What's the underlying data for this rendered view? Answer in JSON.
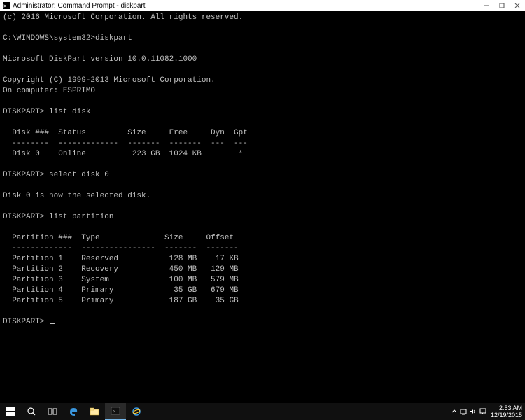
{
  "window": {
    "title": "Administrator: Command Prompt - diskpart",
    "icon": "cmd-icon"
  },
  "terminal": {
    "copyright_line": "(c) 2016 Microsoft Corporation. All rights reserved.",
    "prompt_path": "C:\\WINDOWS\\system32>",
    "cmd1": "diskpart",
    "version_line": "Microsoft DiskPart version 10.0.11082.1000",
    "copyright2": "Copyright (C) 1999-2013 Microsoft Corporation.",
    "computer_line": "On computer: ESPRIMO",
    "dp_prompt": "DISKPART>",
    "cmd_list_disk": "list disk",
    "disk_header": "  Disk ###  Status         Size     Free     Dyn  Gpt",
    "disk_sep": "  --------  -------------  -------  -------  ---  ---",
    "disk_row": "  Disk 0    Online          223 GB  1024 KB        *",
    "cmd_select": "select disk 0",
    "select_msg": "Disk 0 is now the selected disk.",
    "cmd_list_part": "list partition",
    "part_header": "  Partition ###  Type              Size     Offset",
    "part_sep": "  -------------  ----------------  -------  -------",
    "part_rows": [
      "  Partition 1    Reserved           128 MB    17 KB",
      "  Partition 2    Recovery           450 MB   129 MB",
      "  Partition 3    System             100 MB   579 MB",
      "  Partition 4    Primary             35 GB   679 MB",
      "  Partition 5    Primary            187 GB    35 GB"
    ]
  },
  "taskbar": {
    "time": "2:53 AM",
    "date": "12/19/2015"
  }
}
